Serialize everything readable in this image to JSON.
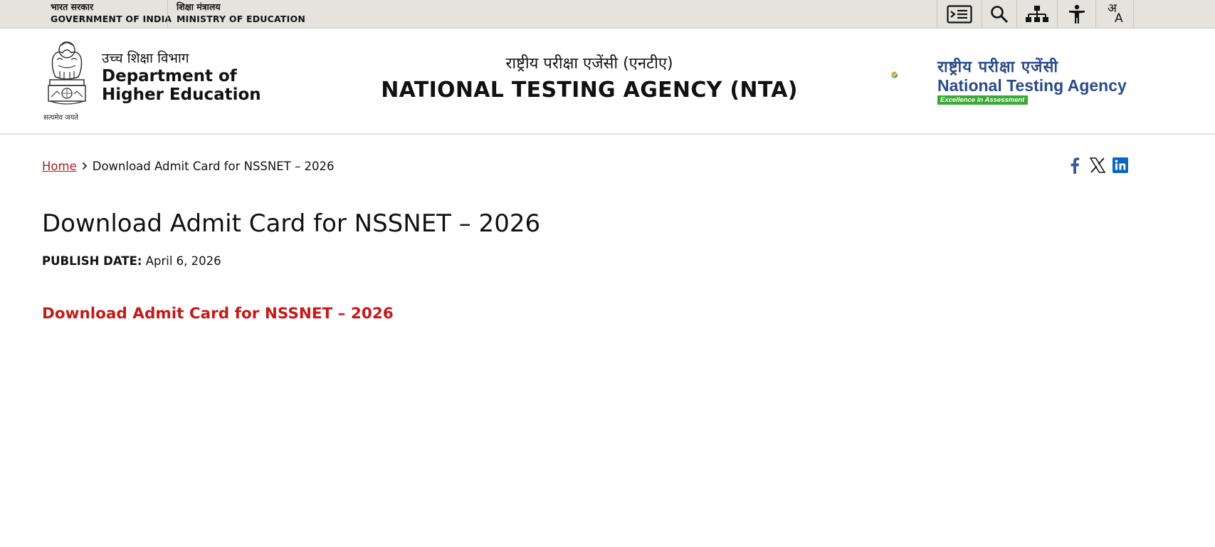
{
  "topbar": {
    "gov_hi": "भारत सरकार",
    "gov_en": "GOVERNMENT OF INDIA",
    "ministry_hi": "शिक्षा मंत्रालय",
    "ministry_en": "MINISTRY OF EDUCATION",
    "tools": [
      "skip-to-main-content-icon",
      "search-icon",
      "sitemap-icon",
      "accessibility-icon",
      "language-icon"
    ],
    "lang_glyph_top": "अ",
    "lang_glyph_bottom": "A"
  },
  "header": {
    "emblem_motto": "सत्यमेव जयते",
    "dept_hi": "उच्च शिक्षा विभाग",
    "dept_en": "Department of Higher Education",
    "title_hi": "राष्ट्रीय परीक्षा एजेंसी (एनटीए)",
    "title_en": "NATIONAL TESTING AGENCY (NTA)",
    "nta_logo_hi": "राष्ट्रीय परीक्षा एजेंसी",
    "nta_logo_en": "National Testing Agency",
    "nta_logo_tagline": "Excellence in Assessment"
  },
  "breadcrumb": {
    "home": "Home",
    "current": "Download Admit Card for NSSNET – 2026"
  },
  "social": [
    "facebook-icon",
    "x-icon",
    "linkedin-icon"
  ],
  "main": {
    "title": "Download Admit Card for NSSNET – 2026",
    "publish_label": "PUBLISH DATE:",
    "publish_date": "April 6, 2026",
    "download_link": "Download Admit Card for NSSNET – 2026"
  },
  "colors": {
    "topbar_bg": "#e6e3de",
    "link_red": "#c41a1a",
    "nta_blue": "#2b4a8a",
    "nta_green": "#3aa935",
    "nta_orange": "#f59a3d"
  }
}
